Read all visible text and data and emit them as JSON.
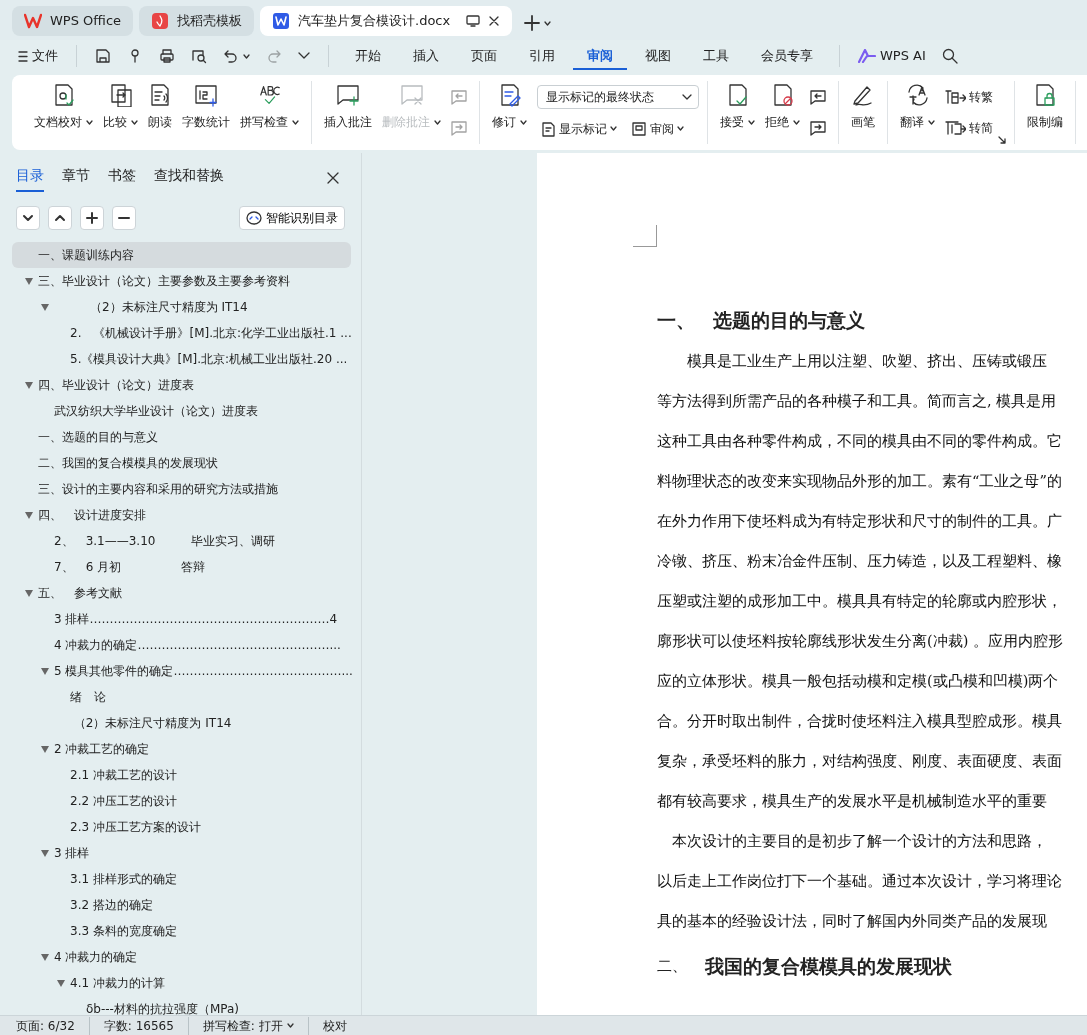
{
  "app_tabs": [
    {
      "label": "WPS Office",
      "kind": "home",
      "selected": false
    },
    {
      "label": "找稻壳模板",
      "kind": "template",
      "selected": false
    },
    {
      "label": "汽车垫片复合模设计.docx",
      "kind": "document",
      "selected": true
    }
  ],
  "menu": {
    "file": "文件",
    "tabs": [
      {
        "label": "开始",
        "selected": false
      },
      {
        "label": "插入",
        "selected": false
      },
      {
        "label": "页面",
        "selected": false
      },
      {
        "label": "引用",
        "selected": false
      },
      {
        "label": "审阅",
        "selected": true
      },
      {
        "label": "视图",
        "selected": false
      },
      {
        "label": "工具",
        "selected": false
      },
      {
        "label": "会员专享",
        "selected": false
      }
    ],
    "ai": "WPS AI"
  },
  "ribbon": [
    [
      {
        "kind": "large",
        "label": "文档校对",
        "dropdown": true,
        "disabled": false
      },
      {
        "kind": "large",
        "label": "比较",
        "dropdown": true,
        "disabled": false
      },
      {
        "kind": "large",
        "label": "朗读",
        "dropdown": false,
        "disabled": false
      },
      {
        "kind": "large",
        "label": "字数统计",
        "dropdown": false,
        "disabled": false
      },
      {
        "kind": "large",
        "label": "拼写检查",
        "dropdown": true,
        "disabled": false
      }
    ],
    [
      {
        "kind": "large",
        "label": "插入批注",
        "dropdown": false,
        "disabled": false
      },
      {
        "kind": "large",
        "label": "删除批注",
        "dropdown": true,
        "disabled": true
      },
      {
        "kind": "stack",
        "buttons": [
          {
            "disabled": true
          },
          {
            "disabled": true
          }
        ]
      }
    ],
    [
      {
        "kind": "large",
        "label": "修订",
        "dropdown": true,
        "disabled": false
      },
      {
        "kind": "panel",
        "select": "显示标记的最终状态",
        "buttons": [
          {
            "label": "显示标记",
            "dropdown": true
          },
          {
            "label": "审阅",
            "dropdown": true
          }
        ]
      }
    ],
    [
      {
        "kind": "large",
        "label": "接受",
        "dropdown": true,
        "disabled": false
      },
      {
        "kind": "large",
        "label": "拒绝",
        "dropdown": true,
        "disabled": false
      },
      {
        "kind": "stack",
        "buttons": [
          {
            "disabled": false
          },
          {
            "disabled": false
          }
        ]
      }
    ],
    [
      {
        "kind": "large",
        "label": "画笔",
        "dropdown": false,
        "disabled": false
      }
    ],
    [
      {
        "kind": "large",
        "label": "翻译",
        "dropdown": true,
        "disabled": false
      },
      {
        "kind": "stack",
        "buttons": [
          {
            "label": "转繁",
            "disabled": false
          },
          {
            "label": "转简",
            "disabled": false
          }
        ]
      }
    ],
    [
      {
        "kind": "large",
        "label": "限制编",
        "dropdown": false,
        "disabled": false
      }
    ]
  ],
  "sidebar": {
    "tabs": [
      {
        "label": "目录",
        "selected": true
      },
      {
        "label": "章节",
        "selected": false
      },
      {
        "label": "书签",
        "selected": false
      },
      {
        "label": "查找和替换",
        "selected": false
      }
    ],
    "toc_button": "智能识别目录",
    "outline": [
      {
        "text": "一、课题训练内容",
        "selected": true
      },
      {
        "text": "三、毕业设计（论文）主要参数及主要参考资料",
        "selected": false,
        "expanded": true,
        "children": [
          {
            "text": "　　　（2）未标注尺寸精度为 IT14",
            "selected": false,
            "expanded": true,
            "children": [
              {
                "text": "2.　《机械设计手册》[M].北京:化学工业出版社.1 ...",
                "selected": false
              },
              {
                "text": "5.《模具设计大典》[M].北京:机械工业出版社.20 ...",
                "selected": false
              }
            ]
          }
        ]
      },
      {
        "text": "四、毕业设计（论文）进度表",
        "selected": false,
        "expanded": true,
        "children": [
          {
            "text": "武汉纺织大学毕业设计（论文）进度表",
            "selected": false
          }
        ]
      },
      {
        "text": "一、选题的目的与意义",
        "selected": false
      },
      {
        "text": "二、我国的复合模模具的发展现状",
        "selected": false
      },
      {
        "text": "三、设计的主要内容和采用的研究方法或措施",
        "selected": false
      },
      {
        "text": "四、　设计进度安排",
        "selected": false,
        "expanded": true,
        "children": [
          {
            "text": "2、　3.1——3.10　　　毕业实习、调研",
            "selected": false
          },
          {
            "text": "7、　6 月初　　　　　答辩",
            "selected": false
          }
        ]
      },
      {
        "text": "五、　参考文献",
        "selected": false,
        "expanded": true,
        "children": [
          {
            "text": "3 排样……………………………………………………4",
            "selected": false
          },
          {
            "text": "4 冲裁力的确定…………………………………………...",
            "selected": false
          },
          {
            "text": "5 模具其他零件的确定……………………………………...",
            "selected": false,
            "expanded": true,
            "children": [
              {
                "text": "绪　论",
                "selected": false
              },
              {
                "text": " （2）未标注尺寸精度为 IT14",
                "selected": false
              }
            ]
          },
          {
            "text": "2 冲裁工艺的确定",
            "selected": false,
            "expanded": true,
            "children": [
              {
                "text": "2.1 冲裁工艺的设计",
                "selected": false
              },
              {
                "text": "2.2 冲压工艺的设计",
                "selected": false
              },
              {
                "text": "2.3 冲压工艺方案的设计",
                "selected": false
              }
            ]
          },
          {
            "text": "3 排样",
            "selected": false,
            "expanded": true,
            "children": [
              {
                "text": "3.1 排样形式的确定",
                "selected": false
              },
              {
                "text": "3.2 搭边的确定",
                "selected": false
              },
              {
                "text": "3.3 条料的宽度确定",
                "selected": false
              }
            ]
          },
          {
            "text": "4 冲裁力的确定",
            "selected": false,
            "expanded": true,
            "children": [
              {
                "text": "4.1 冲裁力的计算",
                "selected": false,
                "expanded": true,
                "children": [
                  {
                    "text": "δb---材料的抗拉强度（MPa)",
                    "selected": false
                  }
                ]
              }
            ]
          }
        ]
      }
    ]
  },
  "document": [
    {
      "kind": "heading",
      "number": "一、",
      "text": "选题的目的与意义"
    },
    {
      "kind": "line",
      "text": "　　模具是工业生产上用以注塑、吹塑、挤出、压铸或锻压"
    },
    {
      "kind": "line",
      "text": "等方法得到所需产品的各种模子和工具。简而言之, 模具是用"
    },
    {
      "kind": "line",
      "text": "这种工具由各种零件构成，不同的模具由不同的零件构成。它"
    },
    {
      "kind": "line",
      "text": "料物理状态的改变来实现物品外形的加工。素有“工业之母”的"
    },
    {
      "kind": "line",
      "text": "在外力作用下使坯料成为有特定形状和尺寸的制件的工具。广"
    },
    {
      "kind": "line",
      "text": "冷镦、挤压、粉末冶金件压制、压力铸造，以及工程塑料、橡"
    },
    {
      "kind": "line",
      "text": "压塑或注塑的成形加工中。模具具有特定的轮廓或内腔形状，"
    },
    {
      "kind": "line",
      "text": "廓形状可以使坯料按轮廓线形状发生分离(冲裁) 。应用内腔形"
    },
    {
      "kind": "line",
      "text": "应的立体形状。模具一般包括动模和定模(或凸模和凹模)两个"
    },
    {
      "kind": "line",
      "text": "合。分开时取出制件，合拢时使坯料注入模具型腔成形。模具"
    },
    {
      "kind": "line",
      "text": "复杂，承受坯料的胀力，对结构强度、刚度、表面硬度、表面"
    },
    {
      "kind": "line",
      "text": "都有较高要求，模具生产的发展水平是机械制造水平的重要"
    },
    {
      "kind": "line",
      "text": "　本次设计的主要目的是初步了解一个设计的方法和思路，"
    },
    {
      "kind": "line",
      "text": "以后走上工作岗位打下一个基础。通过本次设计，学习将理论"
    },
    {
      "kind": "line",
      "text": "具的基本的经验设计法，同时了解国内外同类产品的发展现"
    },
    {
      "kind": "heading2",
      "number": "二、",
      "text": "我国的复合模模具的发展现状"
    }
  ],
  "status_bar": [
    {
      "text": "页面: 6/32",
      "dropdown": false
    },
    {
      "text": "字数: 16565",
      "dropdown": false
    },
    {
      "text": "拼写检查: 打开",
      "dropdown": true
    },
    {
      "text": "校对",
      "dropdown": false
    }
  ]
}
